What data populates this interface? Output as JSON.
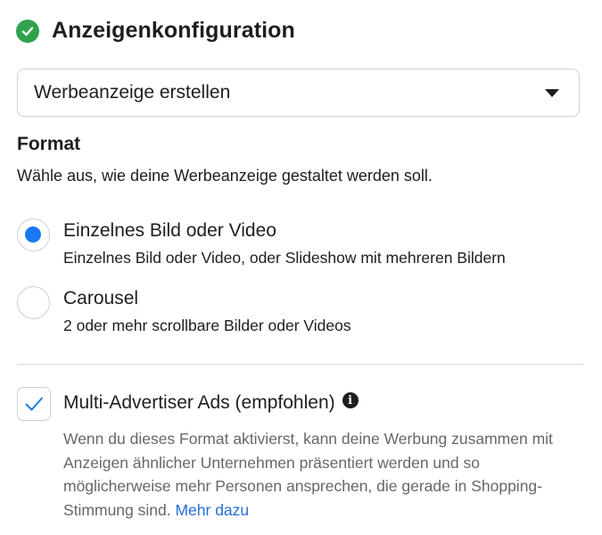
{
  "header": {
    "title": "Anzeigenkonfiguration",
    "status_icon": "check-circle-icon",
    "status_color": "#31a24c"
  },
  "dropdown": {
    "value": "Werbeanzeige erstellen",
    "icon": "caret-down-icon"
  },
  "format": {
    "title": "Format",
    "description": "Wähle aus, wie deine Werbeanzeige gestaltet werden soll.",
    "options": [
      {
        "label": "Einzelnes Bild oder Video",
        "sublabel": "Einzelnes Bild oder Video, oder Slideshow mit mehreren Bildern",
        "selected": true
      },
      {
        "label": "Carousel",
        "sublabel": "2 oder mehr scrollbare Bilder oder Videos",
        "selected": false
      }
    ]
  },
  "multi_advertiser": {
    "label": "Multi-Advertiser Ads (empfohlen)",
    "checked": true,
    "info_icon": "info-icon",
    "description": "Wenn du dieses Format aktivierst, kann deine Werbung zusammen mit Anzeigen ähnlicher Unternehmen präsentiert werden und so möglicherweise mehr Personen ansprechen, die gerade in Shopping-Stimmung sind. ",
    "link_text": "Mehr dazu"
  },
  "colors": {
    "accent": "#1877f2",
    "link": "#216fdb",
    "success": "#31a24c",
    "secondary_text": "#65676b"
  }
}
